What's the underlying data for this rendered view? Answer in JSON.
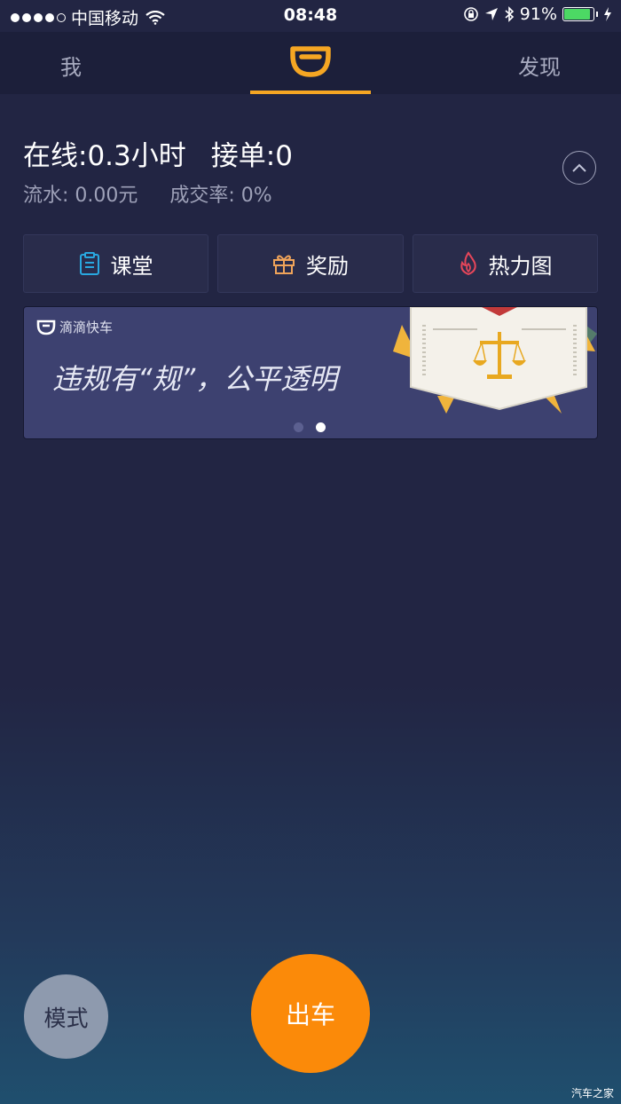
{
  "status_bar": {
    "carrier": "中国移动",
    "time": "08:48",
    "battery_percent": "91%",
    "battery_level": 0.91,
    "signal_bars": 4,
    "icons": [
      "wifi-icon",
      "orientation-lock-icon",
      "location-arrow-icon",
      "bluetooth-icon",
      "battery-icon",
      "charging-icon"
    ]
  },
  "nav": {
    "left_label": "我",
    "right_label": "发现",
    "center_icon": "didi-logo-icon",
    "accent_color": "#f5a623"
  },
  "stats": {
    "online": "在线:0.3小时",
    "orders": "接单:0",
    "revenue": "流水: 0.00元",
    "deal_rate": "成交率: 0%"
  },
  "quick_actions": [
    {
      "label": "课堂",
      "icon": "clipboard-icon",
      "color": "#29a8e0"
    },
    {
      "label": "奖励",
      "icon": "gift-icon",
      "color": "#f0a45a"
    },
    {
      "label": "热力图",
      "icon": "flame-icon",
      "color": "#e6465a"
    }
  ],
  "banner": {
    "brand": "滴滴快车",
    "slogan": "违规有“规”，公平透明",
    "art_icon": "scales-of-justice-icon",
    "page_count": 2,
    "active_page": 2
  },
  "bottom": {
    "mode_label": "模式",
    "go_label": "出车",
    "go_color": "#fb8a09"
  },
  "watermark": "汽车之家"
}
